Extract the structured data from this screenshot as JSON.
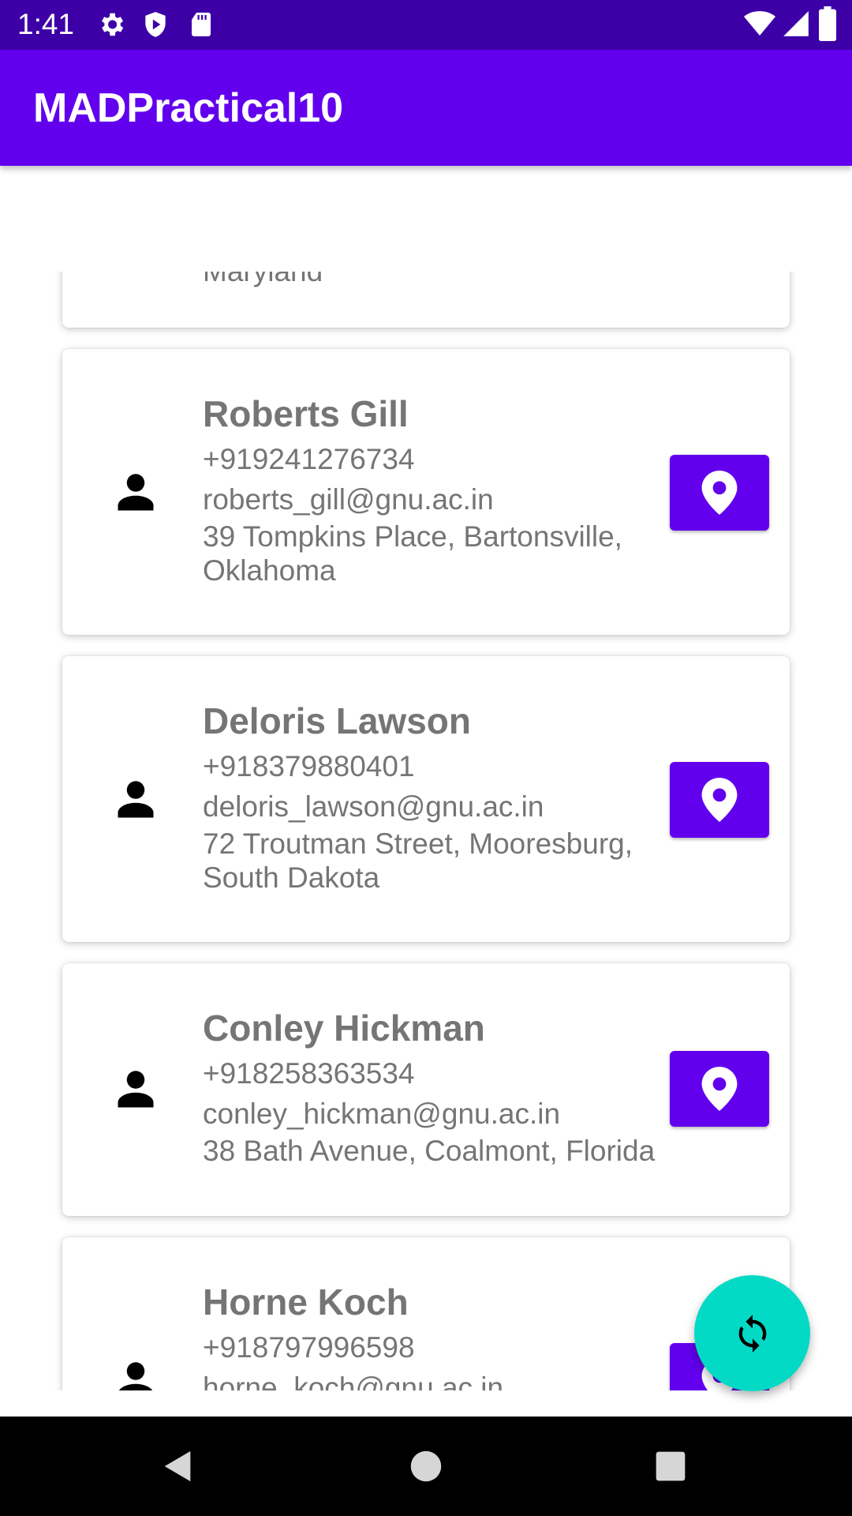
{
  "status_bar": {
    "time": "1:41",
    "left_icons": [
      "settings-icon",
      "shield-play-icon",
      "sd-card-icon"
    ],
    "right_icons": [
      "wifi-icon",
      "cell-signal-icon",
      "battery-icon"
    ],
    "background": "#3d00a7"
  },
  "app_bar": {
    "title": "MADPractical10",
    "background": "#6200ee"
  },
  "contacts": [
    {
      "name": "",
      "phone": "",
      "email": "",
      "address": "Maryland"
    },
    {
      "name": "Roberts Gill",
      "phone": "+919241276734",
      "email": "roberts_gill@gnu.ac.in",
      "address": "39 Tompkins Place, Bartonsville, Oklahoma"
    },
    {
      "name": "Deloris Lawson",
      "phone": "+918379880401",
      "email": "deloris_lawson@gnu.ac.in",
      "address": "72 Troutman Street, Mooresburg, South Dakota"
    },
    {
      "name": "Conley Hickman",
      "phone": "+918258363534",
      "email": "conley_hickman@gnu.ac.in",
      "address": "38 Bath Avenue, Coalmont, Florida"
    },
    {
      "name": "Horne Koch",
      "phone": "+918797996598",
      "email": "horne_koch@gnu.ac.in",
      "address": ""
    }
  ],
  "icons": {
    "contact": "person-icon",
    "map_button": "map-pin-icon",
    "fab": "refresh-icon"
  },
  "colors": {
    "primary": "#6200ee",
    "accent": "#03dac5",
    "text_secondary": "#757575"
  },
  "nav_bar": {
    "buttons": [
      "back-icon",
      "home-icon",
      "recents-icon"
    ]
  }
}
